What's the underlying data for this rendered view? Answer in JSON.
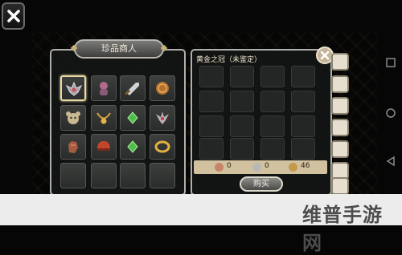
{
  "merchant": {
    "title": "珍品商人"
  },
  "detail": {
    "title": "黄金之冠（未鉴定）"
  },
  "currency": {
    "copper": "0",
    "silver": "0",
    "gold": "46"
  },
  "buy_label": "购买",
  "watermark": "维普手游网",
  "colors": {
    "accent": "#d2c19e",
    "panel_border": "#aeb0ac",
    "gold_coin": "#c49a4a"
  },
  "items": [
    {
      "name": "bat-charm-icon",
      "row": 1,
      "col": 1,
      "selected": true
    },
    {
      "name": "creature-figurine-icon",
      "row": 1,
      "col": 2
    },
    {
      "name": "sword-icon",
      "row": 1,
      "col": 3
    },
    {
      "name": "orb-icon",
      "row": 1,
      "col": 4
    },
    {
      "name": "beast-head-icon",
      "row": 2,
      "col": 1
    },
    {
      "name": "amulet-chain-icon",
      "row": 2,
      "col": 2
    },
    {
      "name": "green-gem-icon",
      "row": 2,
      "col": 3
    },
    {
      "name": "winged-charm-icon",
      "row": 2,
      "col": 4
    },
    {
      "name": "gauntlet-icon",
      "row": 3,
      "col": 1
    },
    {
      "name": "helmet-icon",
      "row": 3,
      "col": 2
    },
    {
      "name": "green-gem-icon",
      "row": 3,
      "col": 3
    },
    {
      "name": "gold-ring-icon",
      "row": 3,
      "col": 4
    }
  ],
  "tabs": [
    "bag-icon",
    "bag-icon",
    "bag-icon",
    "bag-icon",
    "bag-icon",
    "bag-icon",
    "bag-icon"
  ]
}
